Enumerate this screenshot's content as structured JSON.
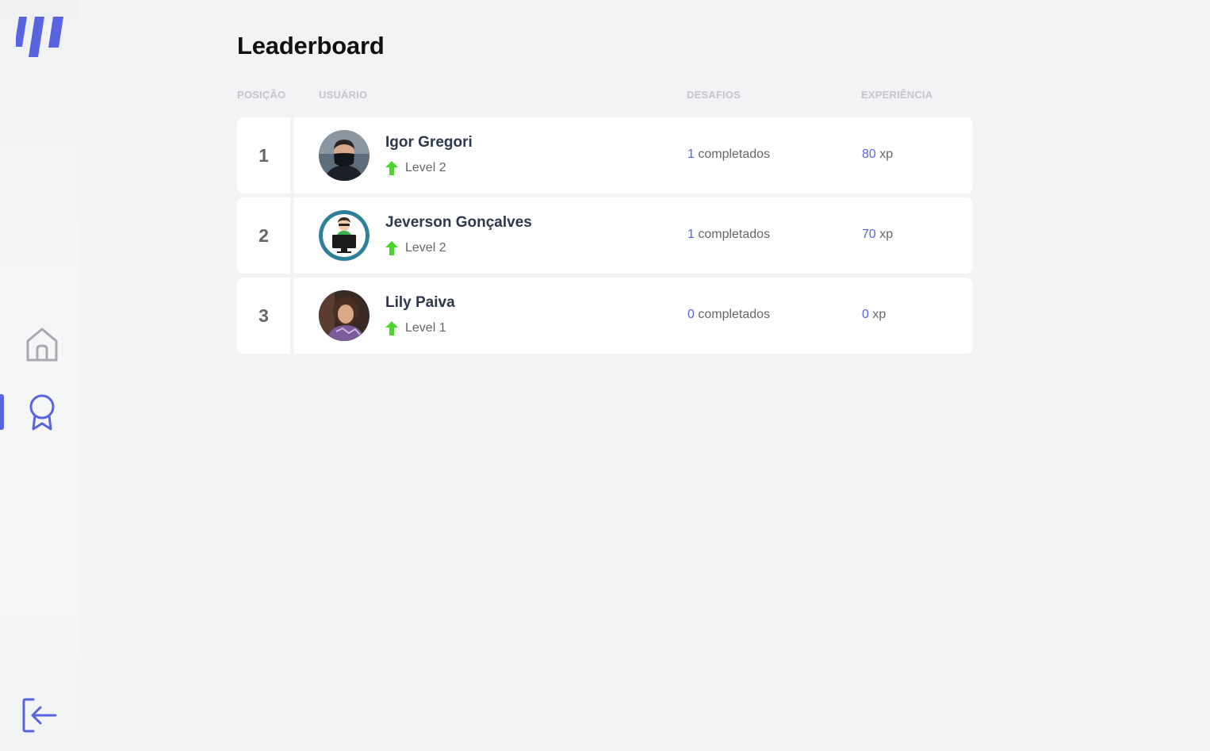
{
  "sidebar": {
    "logo_icon": "moveit-logo-icon",
    "nav": [
      {
        "name": "home",
        "icon": "home-icon",
        "active": false
      },
      {
        "name": "leaderboard",
        "icon": "award-icon",
        "active": true
      }
    ],
    "logout_icon": "logout-icon"
  },
  "page": {
    "title": "Leaderboard"
  },
  "table": {
    "headers": {
      "position": "POSIÇÃO",
      "user": "USUÁRIO",
      "challenges": "DESAFIOS",
      "experience": "EXPERIÊNCIA"
    },
    "rows": [
      {
        "position": "1",
        "name": "Igor Gregori",
        "level": "Level 2",
        "challenges": "1",
        "challenges_suffix": " completados",
        "xp": "80",
        "xp_suffix": " xp"
      },
      {
        "position": "2",
        "name": "Jeverson Gonçalves",
        "level": "Level 2",
        "challenges": "1",
        "challenges_suffix": " completados",
        "xp": "70",
        "xp_suffix": " xp"
      },
      {
        "position": "3",
        "name": "Lily Paiva",
        "level": "Level 1",
        "challenges": "0",
        "challenges_suffix": " completados",
        "xp": "0",
        "xp_suffix": " xp"
      }
    ]
  },
  "colors": {
    "accent": "#5965e0",
    "level_up": "#4cd62b",
    "background": "#f2f3f5"
  }
}
